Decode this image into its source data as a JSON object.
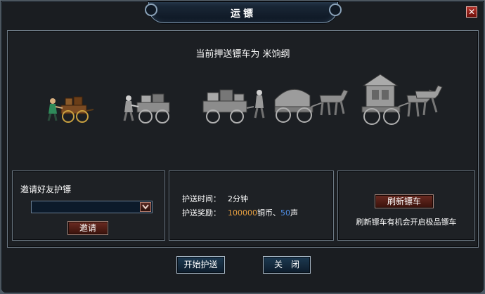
{
  "window": {
    "title": "运镖",
    "close_icon": "close-icon"
  },
  "escort": {
    "status_text": "当前押送镖车为 米饷纲"
  },
  "carts": [
    {
      "name": "cart-level-1-icon",
      "colored": true
    },
    {
      "name": "cart-level-2-icon",
      "colored": false
    },
    {
      "name": "cart-level-3-icon",
      "colored": false
    },
    {
      "name": "cart-level-4-icon",
      "colored": false
    },
    {
      "name": "cart-level-5-icon",
      "colored": false
    }
  ],
  "invite": {
    "title": "邀请好友护镖",
    "select_value": "",
    "button_label": "邀请"
  },
  "info": {
    "time_label": "护送时间：",
    "time_value": "2分钟",
    "reward_label": "护送奖励：",
    "reward_copper": "100000",
    "reward_copper_unit": "铜币、",
    "reward_fame": "50",
    "reward_fame_unit": "声"
  },
  "refresh": {
    "button_label": "刷新镖车",
    "note": "刷新镖车有机会开启极品镖车"
  },
  "footer": {
    "start_label": "开始护送",
    "close_label": "关闭"
  },
  "colors": {
    "orange_value": "#e8a040",
    "blue_value": "#4f8fe8"
  }
}
